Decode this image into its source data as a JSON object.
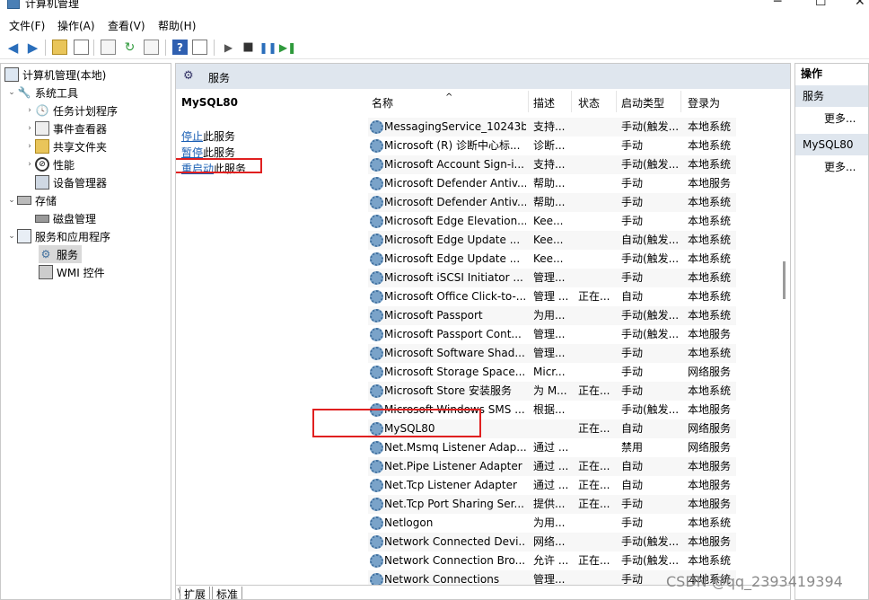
{
  "window": {
    "title": "计算机管理"
  },
  "menu": [
    "文件(F)",
    "操作(A)",
    "查看(V)",
    "帮助(H)"
  ],
  "tree": {
    "root": "计算机管理(本地)",
    "system_tools": "系统工具",
    "task_scheduler": "任务计划程序",
    "event_viewer": "事件查看器",
    "shared_folders": "共享文件夹",
    "performance": "性能",
    "device_manager": "设备管理器",
    "storage": "存储",
    "disk_management": "磁盘管理",
    "services_apps": "服务和应用程序",
    "services": "服务",
    "wmi": "WMI 控件"
  },
  "middle": {
    "header": "服务",
    "selected_service": "MySQL80",
    "stop_link": "停止",
    "stop_suffix": "此服务",
    "pause_link": "暂停",
    "pause_suffix": "此服务",
    "restart_link": "重启动",
    "restart_suffix": "此服务"
  },
  "table": {
    "columns": [
      "名称",
      "描述",
      "状态",
      "启动类型",
      "登录为"
    ],
    "rows": [
      [
        "MessagingService_10243b",
        "支持...",
        "",
        "手动(触发...",
        "本地系统"
      ],
      [
        "Microsoft (R) 诊断中心标...",
        "诊断...",
        "",
        "手动",
        "本地系统"
      ],
      [
        "Microsoft Account Sign-i...",
        "支持...",
        "",
        "手动(触发...",
        "本地系统"
      ],
      [
        "Microsoft Defender Antiv...",
        "帮助...",
        "",
        "手动",
        "本地服务"
      ],
      [
        "Microsoft Defender Antiv...",
        "帮助...",
        "",
        "手动",
        "本地系统"
      ],
      [
        "Microsoft Edge Elevation...",
        "Kee...",
        "",
        "手动",
        "本地系统"
      ],
      [
        "Microsoft Edge Update ...",
        "Kee...",
        "",
        "自动(触发...",
        "本地系统"
      ],
      [
        "Microsoft Edge Update ...",
        "Kee...",
        "",
        "手动(触发...",
        "本地系统"
      ],
      [
        "Microsoft iSCSI Initiator ...",
        "管理...",
        "",
        "手动",
        "本地系统"
      ],
      [
        "Microsoft Office Click-to-...",
        "管理 ...",
        "正在...",
        "自动",
        "本地系统"
      ],
      [
        "Microsoft Passport",
        "为用...",
        "",
        "手动(触发...",
        "本地系统"
      ],
      [
        "Microsoft Passport Cont...",
        "管理...",
        "",
        "手动(触发...",
        "本地服务"
      ],
      [
        "Microsoft Software Shad...",
        "管理...",
        "",
        "手动",
        "本地系统"
      ],
      [
        "Microsoft Storage Space...",
        "Micr...",
        "",
        "手动",
        "网络服务"
      ],
      [
        "Microsoft Store 安装服务",
        "为 M...",
        "正在...",
        "手动",
        "本地系统"
      ],
      [
        "Microsoft Windows SMS ...",
        "根据...",
        "",
        "手动(触发...",
        "本地服务"
      ],
      [
        "MySQL80",
        "",
        "正在...",
        "自动",
        "网络服务"
      ],
      [
        "Net.Msmq Listener Adap...",
        "通过 ...",
        "",
        "禁用",
        "网络服务"
      ],
      [
        "Net.Pipe Listener Adapter",
        "通过 ...",
        "正在...",
        "自动",
        "本地服务"
      ],
      [
        "Net.Tcp Listener Adapter",
        "通过 ...",
        "正在...",
        "自动",
        "本地服务"
      ],
      [
        "Net.Tcp Port Sharing Ser...",
        "提供...",
        "正在...",
        "手动",
        "本地服务"
      ],
      [
        "Netlogon",
        "为用...",
        "",
        "手动",
        "本地系统"
      ],
      [
        "Network Connected Devi...",
        "网络...",
        "",
        "手动(触发...",
        "本地服务"
      ],
      [
        "Network Connection Bro...",
        "允许 ...",
        "正在...",
        "手动(触发...",
        "本地系统"
      ],
      [
        "Network Connections",
        "管理...",
        "",
        "手动",
        "本地系统"
      ]
    ]
  },
  "tabs": [
    "扩展",
    "标准"
  ],
  "actions": {
    "header": "操作",
    "section1": "服务",
    "more1": "更多...",
    "section2": "MySQL80",
    "more2": "更多..."
  },
  "watermark": "CSDN @qq_2393419394"
}
